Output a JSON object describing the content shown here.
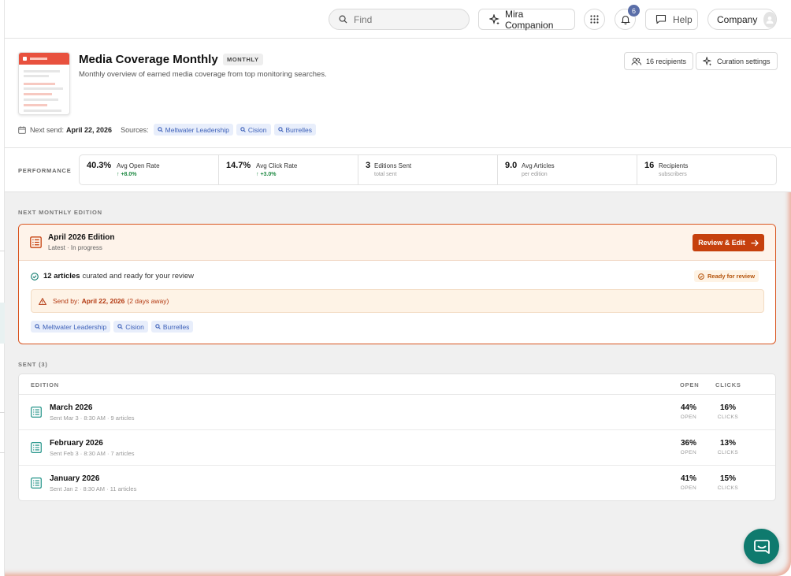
{
  "topbar": {
    "search_placeholder": "Find",
    "companion_label": "Mira Companion",
    "notification_count": "6",
    "help_label": "Help",
    "company_label": "Company"
  },
  "header": {
    "title": "Media Coverage Monthly",
    "frequency_badge": "MONTHLY",
    "description": "Monthly overview of earned media coverage from top monitoring searches.",
    "recipients_button": "16 recipients",
    "curation_button": "Curation settings",
    "next_send_label": "Next send:",
    "next_send_date": "April 22, 2026",
    "sources_label": "Sources:",
    "sources": [
      "Meltwater Leadership",
      "Cision",
      "Burrelles"
    ]
  },
  "performance": {
    "label": "PERFORMANCE",
    "metrics": [
      {
        "value": "40.3%",
        "label": "Avg Open Rate",
        "sub": "↑ +8.0%"
      },
      {
        "value": "14.7%",
        "label": "Avg Click Rate",
        "sub": "↑ +3.0%"
      },
      {
        "value": "3",
        "label": "Editions Sent",
        "sub": "total sent"
      },
      {
        "value": "9.0",
        "label": "Avg Articles",
        "sub": "per edition"
      },
      {
        "value": "16",
        "label": "Recipients",
        "sub": "subscribers"
      }
    ]
  },
  "next_edition": {
    "section_label": "NEXT MONTHLY EDITION",
    "title": "April 2026 Edition",
    "subtitle": "Latest · In progress",
    "review_button": "Review & Edit",
    "articles_count": "12 articles",
    "articles_text": "curated and ready for your review",
    "status": "Ready for review",
    "send_by_label": "Send by:",
    "send_by_date": "April 22, 2026",
    "send_by_note": "(2 days away)",
    "sources": [
      "Meltwater Leadership",
      "Cision",
      "Burrelles"
    ]
  },
  "sent": {
    "section_label": "SENT (3)",
    "columns": {
      "edition": "EDITION",
      "open": "OPEN",
      "clicks": "CLICKS"
    },
    "rows": [
      {
        "title": "March 2026",
        "meta": "Sent Mar 3 · 8:30 AM · 9 articles",
        "open": "44%",
        "open_label": "OPEN",
        "clicks": "16%",
        "clicks_label": "CLICKS"
      },
      {
        "title": "February 2026",
        "meta": "Sent Feb 3 · 8:30 AM · 7 articles",
        "open": "36%",
        "open_label": "OPEN",
        "clicks": "13%",
        "clicks_label": "CLICKS"
      },
      {
        "title": "January 2026",
        "meta": "Sent Jan 2 · 8:30 AM · 11 articles",
        "open": "41%",
        "open_label": "OPEN",
        "clicks": "15%",
        "clicks_label": "CLICKS"
      }
    ]
  },
  "icons": {
    "search": "search-icon",
    "companion": "sparkle-icon",
    "apps": "grid-icon",
    "notifications": "bell-icon",
    "help": "chat-bubble-icon",
    "avatar": "user-icon",
    "recipients": "users-icon",
    "curation": "sparkle-icon",
    "calendar": "calendar-icon",
    "source": "search-icon",
    "edition": "document-icon",
    "arrow": "arrow-right-icon",
    "check": "check-circle-icon",
    "warning": "warning-icon",
    "chat_fab": "chat-icon"
  },
  "colors": {
    "accent": "#c6400d",
    "teal": "#0f7a6e",
    "chip_bg": "#e8eefb",
    "chip_text": "#3b5fb8",
    "positive": "#1f8a43"
  }
}
